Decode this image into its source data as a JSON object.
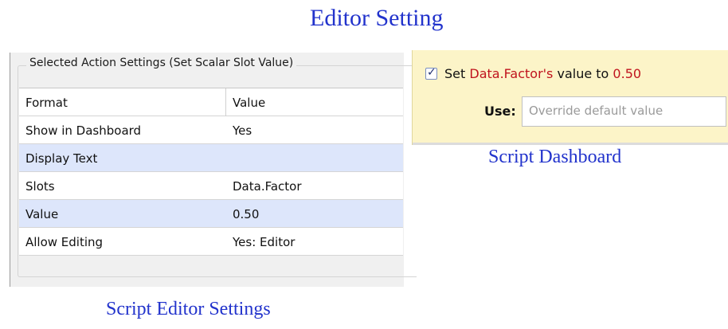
{
  "captions": {
    "title": "Editor Setting",
    "dashboard": "Script Dashboard",
    "editor": "Script Editor Settings"
  },
  "settings": {
    "group_title": "Selected Action Settings (Set Scalar Slot Value)",
    "columns": [
      "Format",
      "Value"
    ],
    "rows": [
      {
        "format": "Show in Dashboard",
        "value": "Yes"
      },
      {
        "format": "Display Text",
        "value": ""
      },
      {
        "format": "Slots",
        "value": "Data.Factor"
      },
      {
        "format": "Value",
        "value": "0.50"
      },
      {
        "format": "Allow Editing",
        "value": "Yes: Editor"
      }
    ]
  },
  "dashboard": {
    "checked": true,
    "check_glyph": "✓",
    "set_prefix": "Set",
    "slot_name": "Data.Factor's",
    "value_to": "value to",
    "value": "0.50",
    "use_label": "Use:",
    "use_placeholder": "Override default value",
    "accent_color": "#c0141e",
    "panel_color": "#fcf4c8"
  }
}
